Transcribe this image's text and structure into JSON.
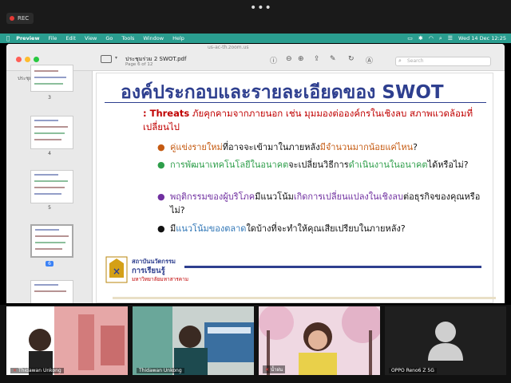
{
  "zoom": {
    "rec_label": "REC",
    "more_label": "•••"
  },
  "menubar": {
    "app_name": "Preview",
    "items": [
      "File",
      "Edit",
      "View",
      "Go",
      "Tools",
      "Window",
      "Help"
    ],
    "clock": "Wed 14 Dec  12:25",
    "colors": {
      "bar": "#2a9d8f"
    }
  },
  "window": {
    "url": "us-ac-th.zoom.us",
    "doc_title": "ประชุมร่วม 2 SWOT.pdf",
    "page_indicator": "Page 6 of 12",
    "search_placeholder": "Search"
  },
  "sidebar": {
    "doc_name": "ประชุมร่วม 2 SWOT.pdf",
    "thumbs": [
      {
        "num": "3"
      },
      {
        "num": "4"
      },
      {
        "num": "5"
      },
      {
        "num": "6",
        "selected": true
      }
    ]
  },
  "slide": {
    "title": "องค์ประกอบและรายละเอียดของ SWOT",
    "threats_en": ": Threats",
    "threats_th": " ภัยคุกคามจากภายนอก เช่น มุมมองต่อองค์กรในเชิงลบ สภาพแวดล้อมที่เปลี่ยนไป",
    "bullets": [
      {
        "a": "คู่แข่งรายใหม่",
        "b": "ที่อาจจะเข้ามาในภายหลัง",
        "c": "มีจำนวนมากน้อยแค่ไหน",
        "d": "?"
      },
      {
        "a": "การพัฒนาเทคโนโลยีในอนาคต",
        "b": "จะเปลี่ยนวิธีการ",
        "c": "ดำเนินงานในอนาคต",
        "d": "ได้หรือไม่?"
      },
      {
        "a": "พฤติกรรมของผู้บริโภค",
        "b": "มีแนวโน้ม",
        "c": "เกิดการเปลี่ยนแปลงในเชิงลบ",
        "d": "ต่อธุรกิจของคุณหรือไม่?"
      },
      {
        "a": "มี",
        "b": "แนวโน้มของตลาด",
        "c": "ใดบ้างที่จะทำให้คุณเสียเปรียบ",
        "d": "ในภายหลัง?"
      }
    ],
    "institute": {
      "line1": "สถาบันนวัตกรรม",
      "line2": "การเรียนรู้",
      "line3": "มหาวิทยาลัยมหาสารคาม"
    },
    "colors": {
      "title": "#2e3f8f",
      "threat": "#c00000"
    }
  },
  "participants": [
    {
      "name": "Thidawan Unkong",
      "muted": true
    },
    {
      "name": "Thidawan Unkong",
      "muted": false
    },
    {
      "name": "น้ำฝน",
      "muted": true
    },
    {
      "name": "OPPO Reno6 Z 5G",
      "muted": false
    }
  ]
}
